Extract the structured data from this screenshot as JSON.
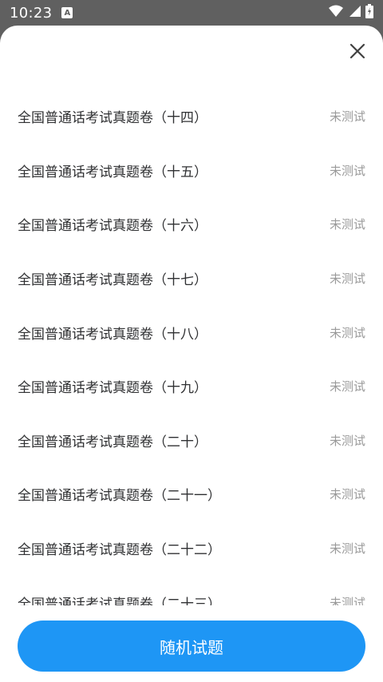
{
  "status_bar": {
    "time": "10:23",
    "app_badge": "A",
    "icons": [
      "wifi-icon",
      "signal-icon",
      "battery-icon"
    ]
  },
  "sheet": {
    "close_icon": "close-icon",
    "items": [
      {
        "title": "全国普通话考试真题卷（十四）",
        "status": "未测试"
      },
      {
        "title": "全国普通话考试真题卷（十五）",
        "status": "未测试"
      },
      {
        "title": "全国普通话考试真题卷（十六）",
        "status": "未测试"
      },
      {
        "title": "全国普通话考试真题卷（十七）",
        "status": "未测试"
      },
      {
        "title": "全国普通话考试真题卷（十八）",
        "status": "未测试"
      },
      {
        "title": "全国普通话考试真题卷（十九）",
        "status": "未测试"
      },
      {
        "title": "全国普通话考试真题卷（二十）",
        "status": "未测试"
      },
      {
        "title": "全国普通话考试真题卷（二十一）",
        "status": "未测试"
      },
      {
        "title": "全国普通话考试真题卷（二十二）",
        "status": "未测试"
      },
      {
        "title": "全国普通话考试真题卷（二十三）",
        "status": "未测试"
      }
    ],
    "random_button_label": "随机试题"
  },
  "colors": {
    "accent": "#1e96f5",
    "status_bar_bg": "#606060",
    "title_text": "#303133",
    "muted_text": "#9a9a9a"
  }
}
